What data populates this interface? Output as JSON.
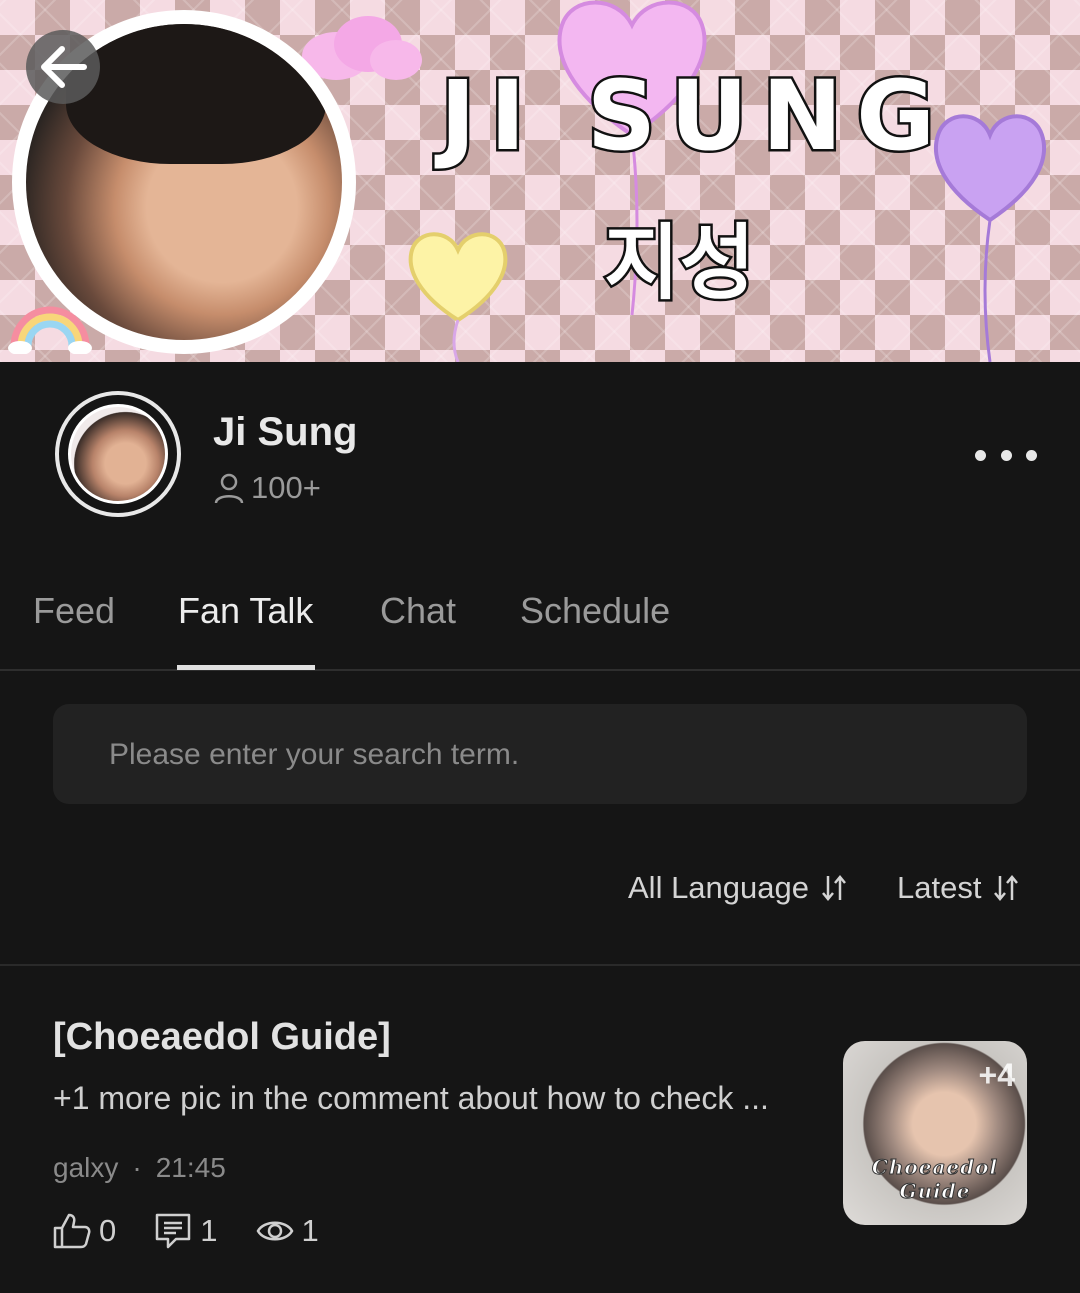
{
  "banner": {
    "title": "JI SUNG",
    "subtitle": "지성"
  },
  "profile": {
    "name": "Ji Sung",
    "members": "100+"
  },
  "tabs": [
    {
      "label": "Feed",
      "active": false
    },
    {
      "label": "Fan Talk",
      "active": true
    },
    {
      "label": "Chat",
      "active": false
    },
    {
      "label": "Schedule",
      "active": false
    }
  ],
  "search": {
    "placeholder": "Please enter your search term."
  },
  "filters": {
    "language": "All Language",
    "sort": "Latest"
  },
  "post": {
    "title": "[Choeaedol Guide]",
    "body": "+1 more pic in the comment about how to check ...",
    "author": "galxy",
    "separator": "·",
    "time": "21:45",
    "likes": "0",
    "comments": "1",
    "views": "1",
    "thumbnail_count": "+4",
    "thumbnail_caption": "Choeaedol Guide"
  },
  "colors": {
    "background": "#151515",
    "banner_pink": "#f5dbe2",
    "text_primary": "#e8e8e8",
    "text_muted": "#9a9a9a"
  },
  "icons": [
    "back-arrow-icon",
    "person-icon",
    "more-dots-icon",
    "sort-icon",
    "thumbs-up-icon",
    "comment-icon",
    "eye-icon"
  ]
}
